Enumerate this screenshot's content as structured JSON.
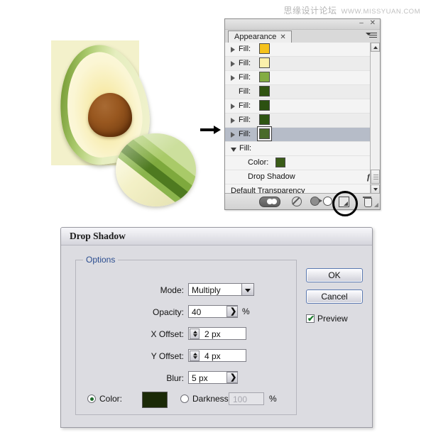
{
  "watermark": {
    "cn": "思缘设计论坛",
    "url": "WWW.MISSYUAN.COM"
  },
  "artwork": {
    "name": "avocado-half-illustration",
    "background_color": "#f3f1cb",
    "skin_color": "#5e7c2b",
    "flesh_color": "#f8eeb6",
    "pit_color": "#8b4f1c"
  },
  "magnifier": {
    "name": "zoom-detail-bubble"
  },
  "appearance_panel": {
    "tab_label": "Appearance",
    "tab_close": "✕",
    "window_buttons": "– ✕",
    "rows": [
      {
        "label": "Fill:",
        "swatch": "#f5c21c",
        "disclosure": "right",
        "indent": 0,
        "selected": false,
        "alt": false
      },
      {
        "label": "Fill:",
        "swatch": "#fbf0ab",
        "disclosure": "right",
        "indent": 0,
        "selected": false,
        "alt": true
      },
      {
        "label": "Fill:",
        "swatch": "#83ac43",
        "disclosure": "right",
        "indent": 0,
        "selected": false,
        "alt": false
      },
      {
        "label": "Fill:",
        "swatch": "#2f5310",
        "disclosure": "none",
        "indent": 0,
        "selected": false,
        "alt": true
      },
      {
        "label": "Fill:",
        "swatch": "#2c5111",
        "disclosure": "right",
        "indent": 0,
        "selected": false,
        "alt": false
      },
      {
        "label": "Fill:",
        "swatch": "#2d5413",
        "disclosure": "right",
        "indent": 0,
        "selected": false,
        "alt": true
      },
      {
        "label": "Fill:",
        "swatch": "#4a6b2a",
        "disclosure": "right",
        "indent": 0,
        "selected": true,
        "alt": false
      },
      {
        "label": "Fill:",
        "swatch": null,
        "disclosure": "down",
        "indent": 0,
        "selected": false,
        "alt": false
      }
    ],
    "sub_rows": [
      {
        "label": "Color:",
        "swatch": "#3a5c18",
        "fx": null
      },
      {
        "label": "Drop Shadow",
        "swatch": null,
        "fx": "fx"
      }
    ],
    "footer_row": "Default Transparency",
    "bottom_buttons": [
      {
        "name": "fill-stroke-toggle-button"
      },
      {
        "name": "clear-appearance-button"
      },
      {
        "name": "duplicate-item-button"
      },
      {
        "name": "new-art-has-basic-appearance-button"
      },
      {
        "name": "delete-item-button"
      }
    ]
  },
  "dialog": {
    "title": "Drop Shadow",
    "options_legend": "Options",
    "fields": {
      "mode_label": "Mode:",
      "mode_value": "Multiply",
      "opacity_label": "Opacity:",
      "opacity_value": "40",
      "opacity_unit": "%",
      "x_offset_label": "X Offset:",
      "x_offset_value": "2 px",
      "y_offset_label": "Y Offset:",
      "y_offset_value": "4 px",
      "blur_label": "Blur:",
      "blur_value": "5 px"
    },
    "color_row": {
      "color_label": "Color:",
      "color_selected": true,
      "color_value": "#1b2a07",
      "darkness_label": "Darkness:",
      "darkness_selected": false,
      "darkness_value": "100",
      "darkness_unit": "%"
    },
    "buttons": {
      "ok": "OK",
      "cancel": "Cancel"
    },
    "preview": {
      "label": "Preview",
      "checked": true,
      "tick": "✔"
    }
  }
}
